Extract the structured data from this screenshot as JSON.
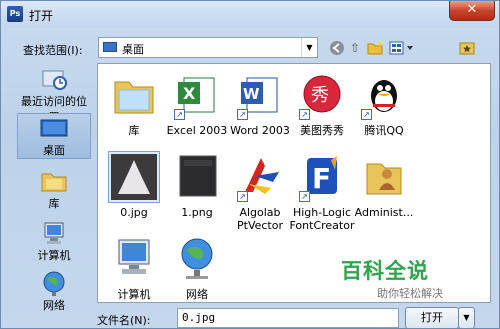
{
  "window": {
    "title": "打开",
    "app_icon": "Ps",
    "close": "✕"
  },
  "lookin": {
    "label": "查找范围(I):",
    "value": "桌面"
  },
  "places": [
    {
      "label": "最近访问的位置",
      "icon": "recent-places-icon"
    },
    {
      "label": "桌面",
      "icon": "desktop-icon",
      "selected": true
    },
    {
      "label": "库",
      "icon": "libraries-icon"
    },
    {
      "label": "计算机",
      "icon": "computer-icon"
    },
    {
      "label": "网络",
      "icon": "network-icon"
    }
  ],
  "files": [
    {
      "label": "库",
      "icon": "folder-icon"
    },
    {
      "label": "Excel 2003",
      "icon": "excel-icon"
    },
    {
      "label": "Word 2003",
      "icon": "word-icon"
    },
    {
      "label": "美图秀秀",
      "icon": "meitu-icon"
    },
    {
      "label": "腾讯QQ",
      "icon": "qq-icon"
    },
    {
      "label": "0.jpg",
      "icon": "image-thumbnail-icon",
      "selected": true
    },
    {
      "label": "1.png",
      "icon": "png-file-icon"
    },
    {
      "label": "Algolab PtVector",
      "icon": "algolab-icon"
    },
    {
      "label": "High-Logic FontCreator",
      "icon": "fontcreator-icon"
    },
    {
      "label": "Administ...",
      "icon": "user-folder-icon"
    },
    {
      "label": "计算机",
      "icon": "computer-icon"
    },
    {
      "label": "网络",
      "icon": "network-icon"
    }
  ],
  "bottom": {
    "filename_label": "文件名(N):",
    "filename_value": "0.jpg",
    "open_label": "打开"
  },
  "watermark": {
    "title": "百科全说",
    "subtitle": "助你轻松解决"
  }
}
